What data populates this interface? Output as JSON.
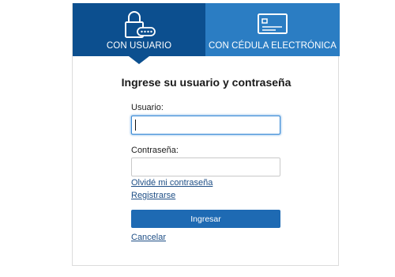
{
  "tabs": [
    {
      "label": "CON USUARIO",
      "icon": "lock-key-icon",
      "active": true
    },
    {
      "label": "CON CÉDULA ELECTRÓNICA",
      "icon": "id-card-icon",
      "active": false
    }
  ],
  "form": {
    "title": "Ingrese su usuario y contraseña",
    "username_label": "Usuario:",
    "username_value": "",
    "password_label": "Contraseña:",
    "password_value": "",
    "forgot_link": "Olvidé mi contraseña",
    "register_link": "Registrarse",
    "submit_label": "Ingresar",
    "cancel_link": "Cancelar"
  },
  "colors": {
    "active_tab": "#0c4f8f",
    "inactive_tab": "#2b7dc3",
    "primary_button": "#1e6ab3",
    "link": "#1f4f86",
    "focus_border": "#3b8bd6"
  }
}
